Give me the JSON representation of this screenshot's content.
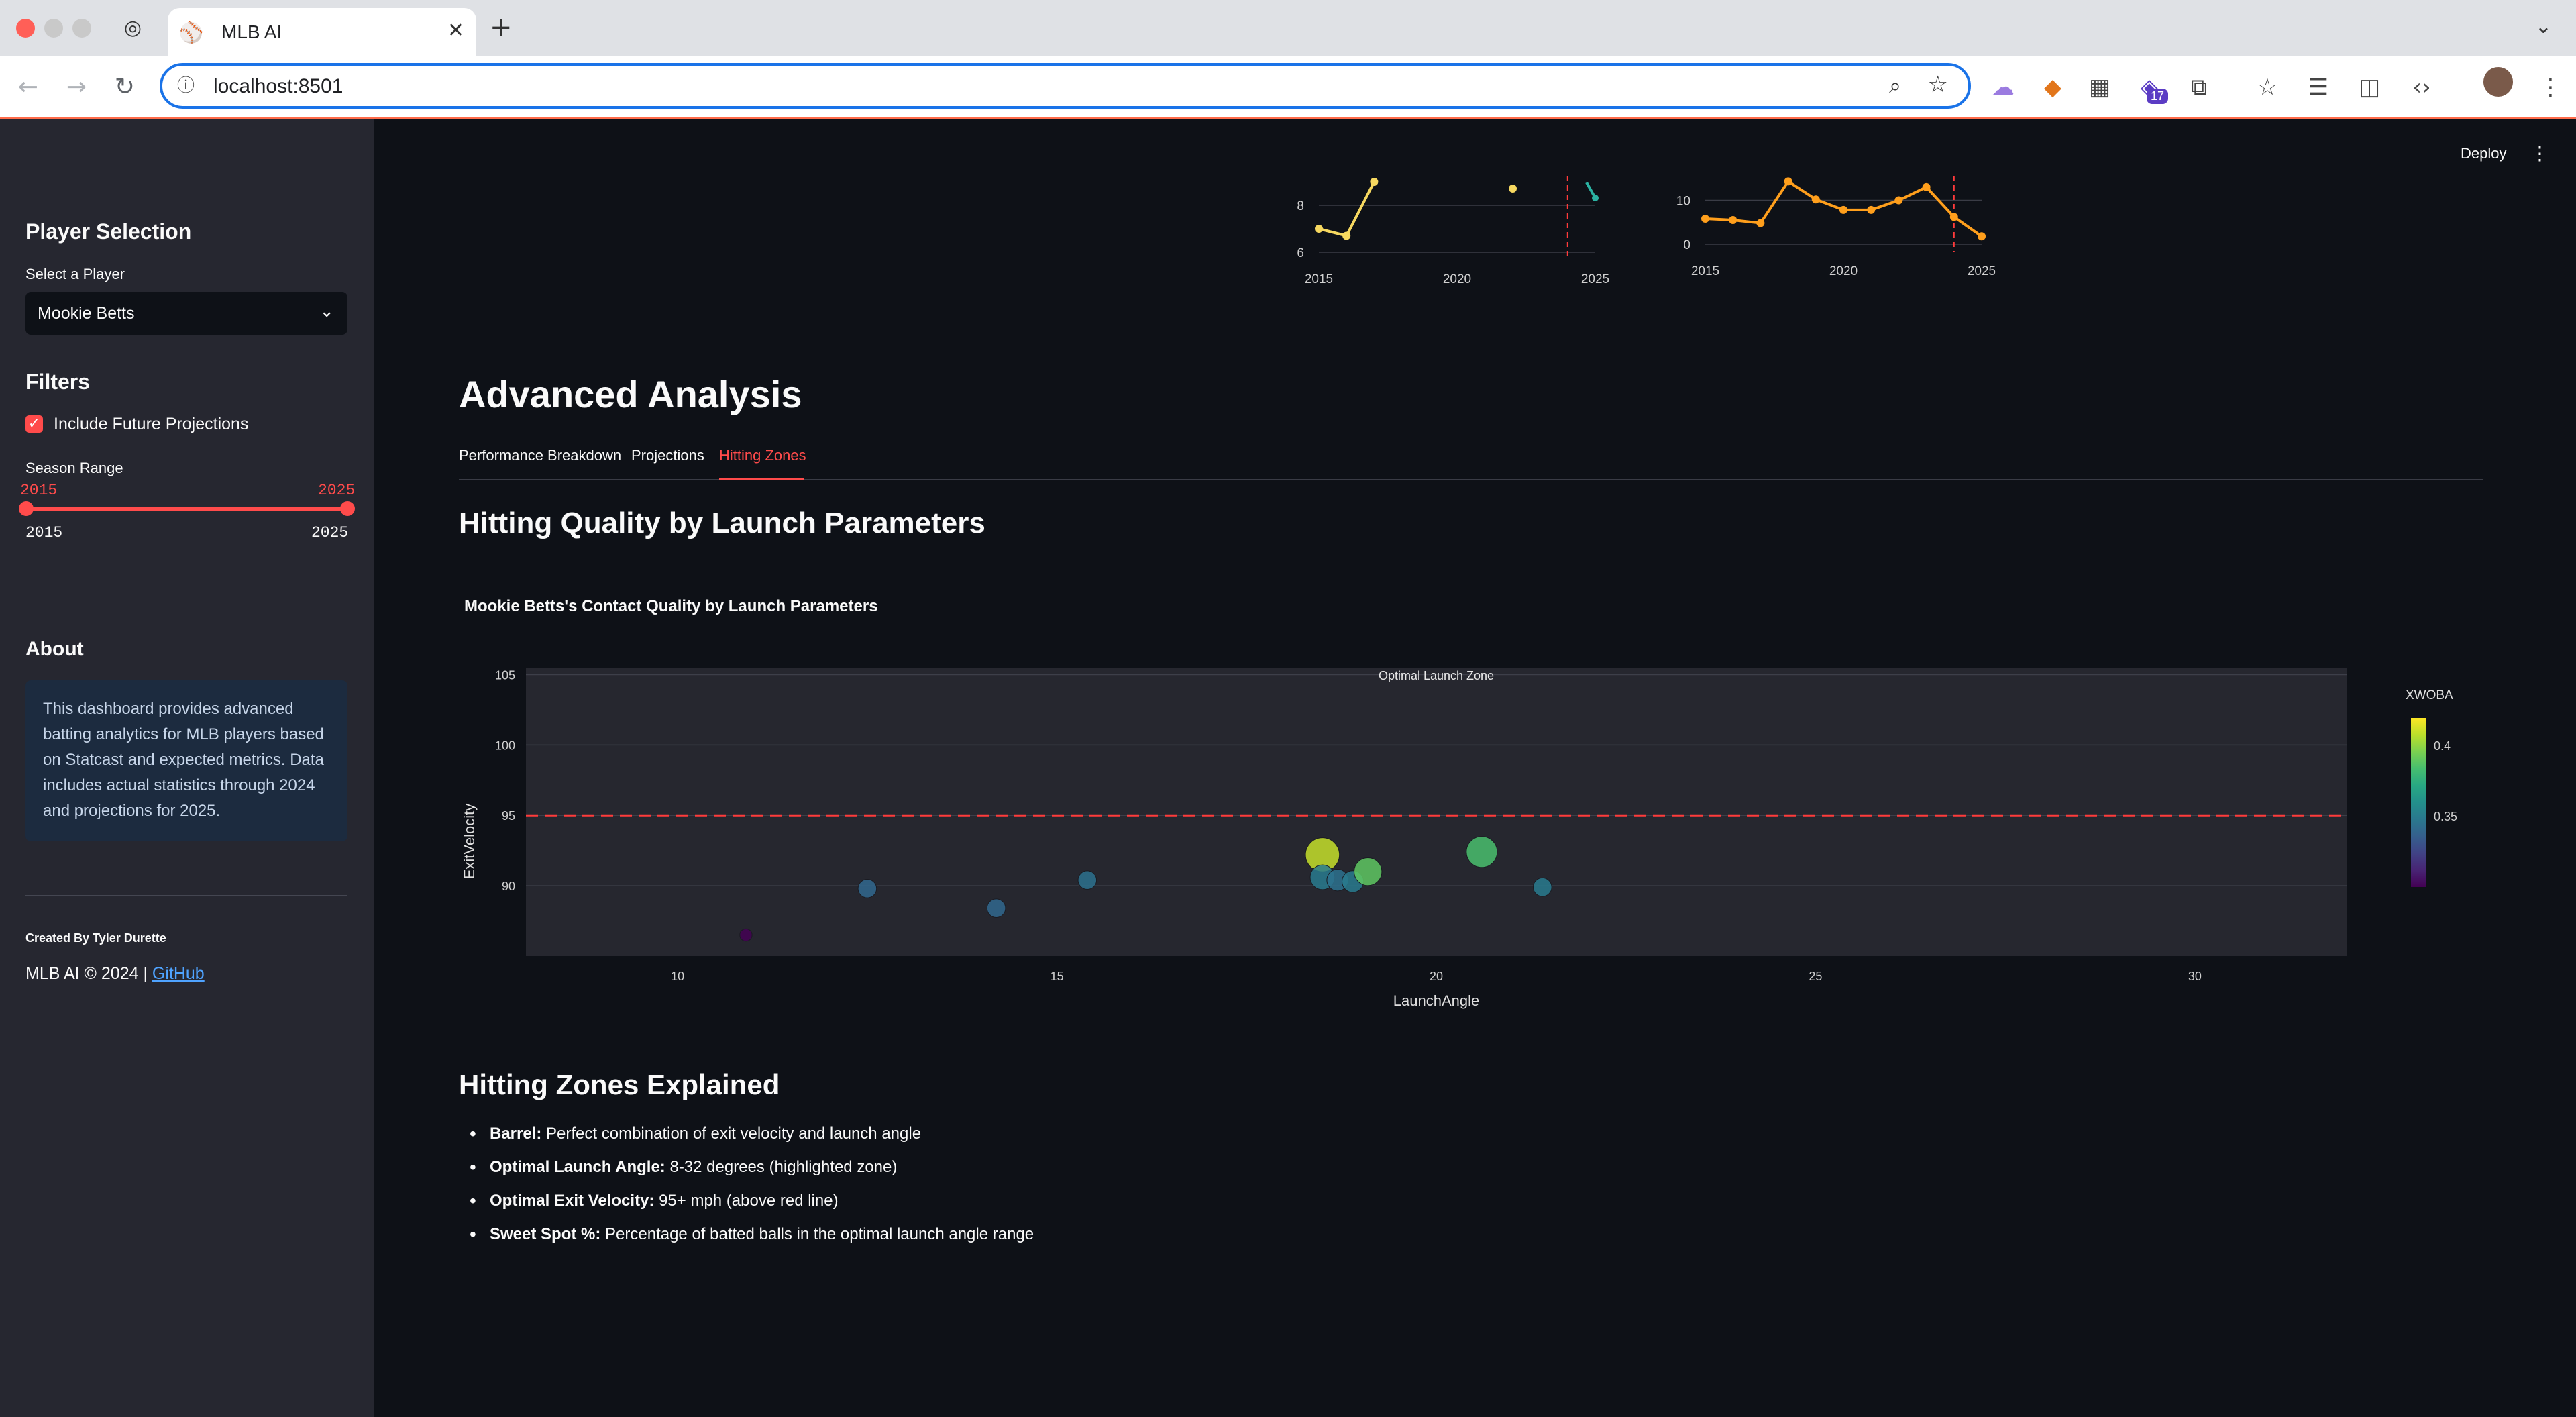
{
  "browser": {
    "tab_title": "MLB AI",
    "url": "localhost:8501",
    "extension_badge": "17"
  },
  "app": {
    "deploy_label": "Deploy"
  },
  "sidebar": {
    "player_selection_heading": "Player Selection",
    "select_label": "Select a Player",
    "selected_player": "Mookie Betts",
    "filters_heading": "Filters",
    "include_future_label": "Include Future Projections",
    "include_future_checked": true,
    "season_range_label": "Season Range",
    "season_range_low": "2015",
    "season_range_high": "2025",
    "season_min": "2015",
    "season_max": "2025",
    "about_heading": "About",
    "about_text": "This dashboard provides advanced batting analytics for MLB players based on Statcast and expected metrics. Data includes actual statistics through 2024 and projections for 2025.",
    "created_by": "Created By Tyler Durette",
    "copyright_prefix": "MLB AI © 2024 | ",
    "github_link": "GitHub"
  },
  "main": {
    "section_title": "Advanced Analysis",
    "tabs": [
      {
        "label": "Performance Breakdown",
        "active": false
      },
      {
        "label": "Projections",
        "active": false
      },
      {
        "label": "Hitting Zones",
        "active": true
      }
    ],
    "subsection_title": "Hitting Quality by Launch Parameters",
    "explained_title": "Hitting Zones Explained",
    "zones": [
      {
        "term": "Barrel:",
        "desc": " Perfect combination of exit velocity and launch angle"
      },
      {
        "term": "Optimal Launch Angle:",
        "desc": " 8-32 degrees (highlighted zone)"
      },
      {
        "term": "Optimal Exit Velocity:",
        "desc": " 95+ mph (above red line)"
      },
      {
        "term": "Sweet Spot %:",
        "desc": " Percentage of batted balls in the optimal launch angle range"
      }
    ]
  },
  "colors": {
    "accent": "#ff4b4b",
    "background": "#0e1117",
    "sidebar": "#262730",
    "orange_series": "#ff9f1c",
    "yellow_series": "#f6d860"
  },
  "chart_data": [
    {
      "type": "line",
      "partial": true,
      "x_ticks": [
        "2015",
        "2020",
        "2025"
      ],
      "y_ticks": [
        "6",
        "8"
      ],
      "series": [
        {
          "x": [
            2015,
            2016,
            2017
          ],
          "y": [
            7.0,
            6.7,
            9.0
          ]
        }
      ],
      "projection_marker_x": 2024
    },
    {
      "type": "line",
      "partial": true,
      "x_ticks": [
        "2015",
        "2020",
        "2025"
      ],
      "y_ticks": [
        "0",
        "10"
      ],
      "series": [
        {
          "x": [
            2015,
            2016,
            2017,
            2018,
            2019,
            2020,
            2021,
            2022,
            2023,
            2024,
            2025
          ],
          "y": [
            5.8,
            5.5,
            4.8,
            14.3,
            10.2,
            7.8,
            7.8,
            10.0,
            13.0,
            6.2,
            1.8
          ]
        }
      ],
      "projection_marker_x": 2024
    },
    {
      "type": "scatter",
      "title": "Mookie Betts's Contact Quality by Launch Parameters",
      "xlabel": "LaunchAngle",
      "ylabel": "ExitVelocity",
      "xlim": [
        8,
        32
      ],
      "ylim": [
        85,
        105.5
      ],
      "x_ticks": [
        10,
        15,
        20,
        25,
        30
      ],
      "y_ticks": [
        90,
        95,
        100,
        105
      ],
      "colorbar_title": "XWOBA",
      "colorbar_ticks": [
        "0.35",
        "0.4"
      ],
      "colorbar_range": [
        0.3,
        0.42
      ],
      "reference_line": {
        "y": 95,
        "style": "dashed",
        "color": "#ff3b3b"
      },
      "annotation": "Optimal Launch Zone",
      "points": [
        {
          "x": 10.9,
          "y": 86.5,
          "xwoba": 0.3,
          "size": 4
        },
        {
          "x": 12.5,
          "y": 89.8,
          "xwoba": 0.34,
          "size": 6
        },
        {
          "x": 14.2,
          "y": 88.4,
          "xwoba": 0.34,
          "size": 6
        },
        {
          "x": 15.4,
          "y": 90.4,
          "xwoba": 0.345,
          "size": 6
        },
        {
          "x": 18.5,
          "y": 92.2,
          "xwoba": 0.41,
          "size": 11
        },
        {
          "x": 18.5,
          "y": 90.6,
          "xwoba": 0.35,
          "size": 8
        },
        {
          "x": 18.7,
          "y": 90.4,
          "xwoba": 0.345,
          "size": 7
        },
        {
          "x": 18.9,
          "y": 90.3,
          "xwoba": 0.35,
          "size": 7
        },
        {
          "x": 19.1,
          "y": 91.0,
          "xwoba": 0.39,
          "size": 9
        },
        {
          "x": 20.6,
          "y": 92.4,
          "xwoba": 0.385,
          "size": 10
        },
        {
          "x": 21.4,
          "y": 89.9,
          "xwoba": 0.35,
          "size": 6
        }
      ]
    }
  ]
}
